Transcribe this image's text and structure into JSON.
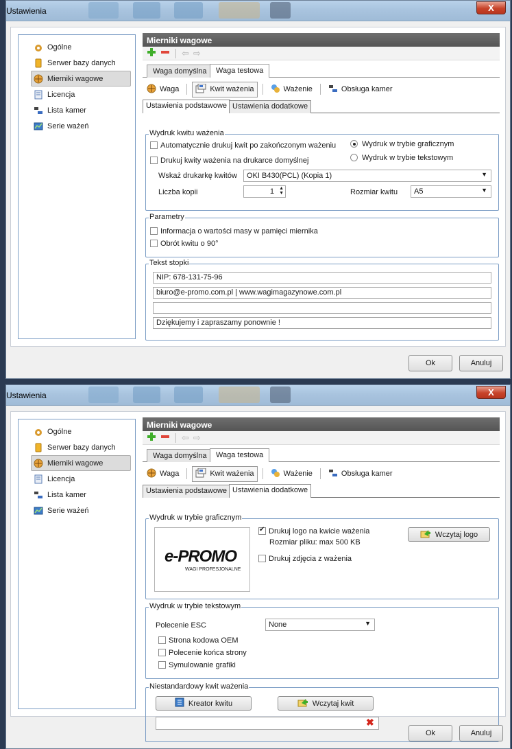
{
  "windows": [
    {
      "title": "Ustawienia",
      "close": "X",
      "sidebar": [
        "Ogólne",
        "Serwer bazy danych",
        "Mierniki wagowe",
        "Licencja",
        "Lista kamer",
        "Serie ważeń"
      ],
      "header": "Mierniki wagowe",
      "top_tabs": [
        "Waga domyślna",
        "Waga testowa"
      ],
      "toolbar": [
        "Waga",
        "Kwit ważenia",
        "Ważenie",
        "Obsługa kamer"
      ],
      "sub_tabs": [
        "Ustawienia podstawowe",
        "Ustawienia dodatkowe"
      ],
      "g1": {
        "label": "Wydruk kwitu ważenia",
        "cb1": "Automatycznie drukuj kwit po zakończonym ważeniu",
        "cb2": "Drukuj kwity ważenia na drukarce domyślnej",
        "r1": "Wydruk w trybie graficznym",
        "r2": "Wydruk w trybie tekstowym",
        "printer_label": "Wskaż drukarkę kwitów",
        "printer_value": "OKI B430(PCL) (Kopia 1)",
        "copies_label": "Liczba kopii",
        "copies_value": "1",
        "size_label": "Rozmiar kwitu",
        "size_value": "A5"
      },
      "g2": {
        "label": "Parametry",
        "cb1": "Informacja o wartości masy w pamięci miernika",
        "cb2": "Obrót kwitu o 90°"
      },
      "g3": {
        "label": "Tekst stopki",
        "lines": [
          "NIP: 678-131-75-96",
          "biuro@e-promo.com.pl  |  www.wagimagazynowe.com.pl",
          "",
          "Dziękujemy i zapraszamy ponownie !"
        ]
      },
      "ok": "Ok",
      "cancel": "Anuluj"
    },
    {
      "title": "Ustawienia",
      "close": "X",
      "sidebar": [
        "Ogólne",
        "Serwer bazy danych",
        "Mierniki wagowe",
        "Licencja",
        "Lista kamer",
        "Serie ważeń"
      ],
      "header": "Mierniki wagowe",
      "top_tabs": [
        "Waga domyślna",
        "Waga testowa"
      ],
      "toolbar": [
        "Waga",
        "Kwit ważenia",
        "Ważenie",
        "Obsługa kamer"
      ],
      "sub_tabs": [
        "Ustawienia podstawowe",
        "Ustawienia dodatkowe"
      ],
      "g1": {
        "label": "Wydruk w trybie graficznym",
        "logo_main": "e-PROMO",
        "logo_sub": "WAGI PROFESJONALNE",
        "cb1": "Drukuj logo na kwicie ważenia",
        "size_note": "Rozmiar pliku: max 500 KB",
        "cb2": "Drukuj zdjęcia z ważenia",
        "load_logo": "Wczytaj logo"
      },
      "g2": {
        "label": "Wydruk w trybie tekstowym",
        "esc_label": "Polecenie ESC",
        "esc_value": "None",
        "cb1": "Strona kodowa OEM",
        "cb2": "Polecenie końca strony",
        "cb3": "Symulowanie grafiki"
      },
      "g3": {
        "label": "Niestandardowy kwit ważenia",
        "creator": "Kreator kwitu",
        "load": "Wczytaj kwit",
        "path": ""
      },
      "ok": "Ok",
      "cancel": "Anuluj"
    }
  ],
  "colors": {
    "group_border": "#7a9cc4",
    "header_bg": "#606060",
    "close_red": "#c7432a",
    "plus_green": "#3fae2a",
    "minus_red": "#e0463a"
  }
}
